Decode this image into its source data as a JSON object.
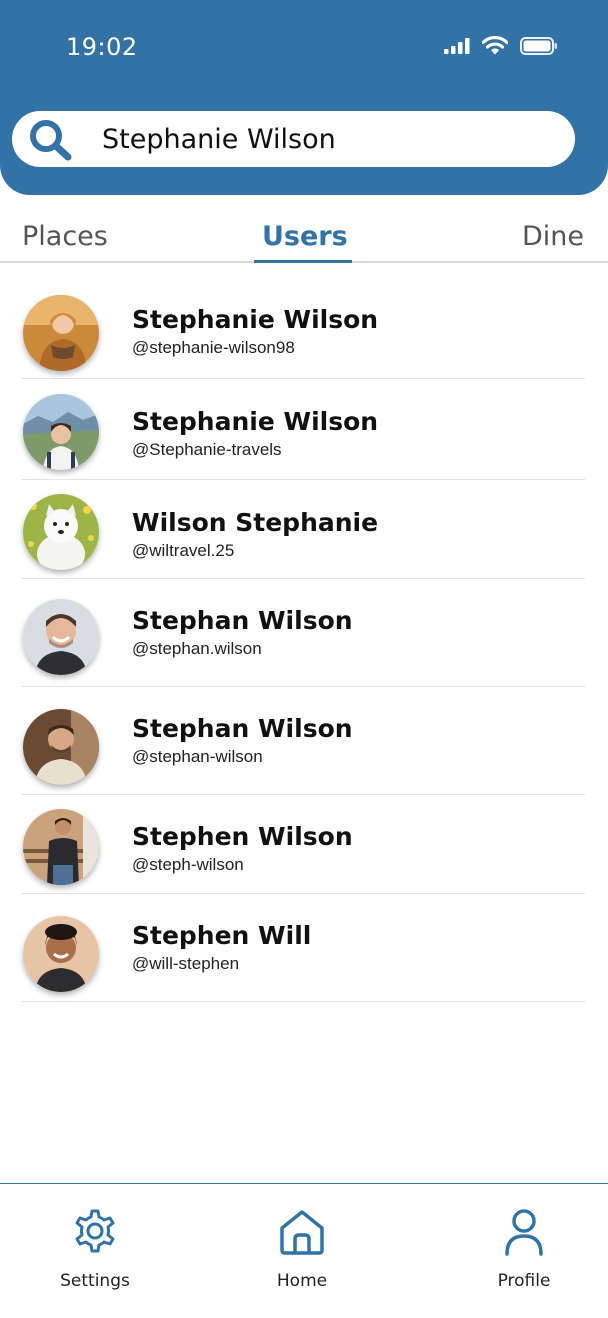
{
  "status_bar": {
    "time": "19:02",
    "icons": [
      "cellular-signal-icon",
      "wifi-icon",
      "battery-icon"
    ]
  },
  "search": {
    "value": "Stephanie Wilson",
    "icon": "search-icon"
  },
  "tabs": [
    {
      "label": "Places",
      "active": false
    },
    {
      "label": "Users",
      "active": true
    },
    {
      "label": "Dine",
      "active": false
    }
  ],
  "users": [
    {
      "name": "Stephanie Wilson",
      "handle": "@stephanie-wilson98"
    },
    {
      "name": "Stephanie Wilson",
      "handle": "@Stephanie-travels"
    },
    {
      "name": "Wilson Stephanie",
      "handle": "@wiltravel.25"
    },
    {
      "name": "Stephan Wilson",
      "handle": "@stephan.wilson"
    },
    {
      "name": "Stephan Wilson",
      "handle": "@stephan-wilson"
    },
    {
      "name": "Stephen Wilson",
      "handle": "@steph-wilson"
    },
    {
      "name": "Stephen Will",
      "handle": "@will-stephen"
    }
  ],
  "bottom_nav": [
    {
      "label": "Settings",
      "icon": "gear-icon"
    },
    {
      "label": "Home",
      "icon": "home-icon"
    },
    {
      "label": "Profile",
      "icon": "person-icon"
    }
  ],
  "colors": {
    "brand": "#3272a5",
    "background": "#ffffff",
    "divider": "#e2e2e2"
  }
}
